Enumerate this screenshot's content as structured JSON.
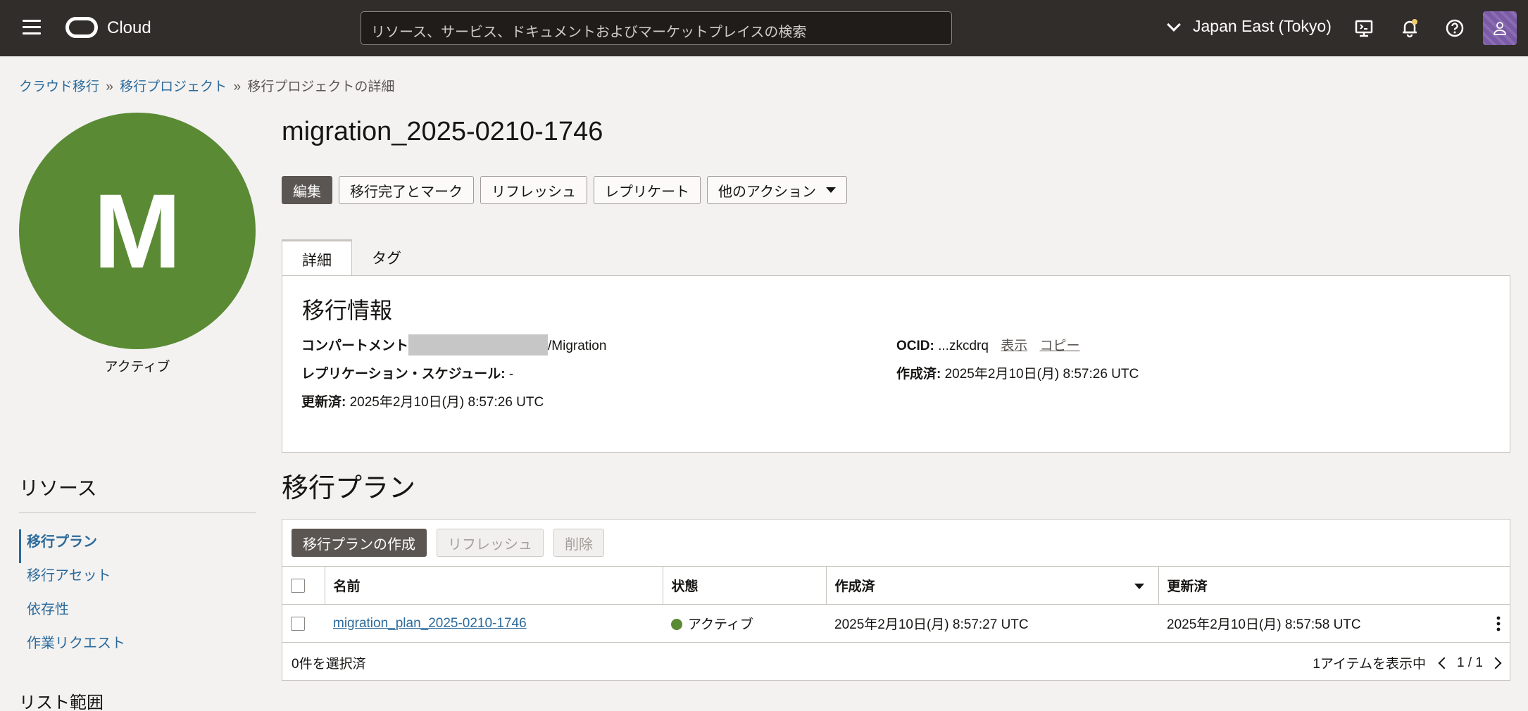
{
  "header": {
    "brand": "Cloud",
    "search_placeholder": "リソース、サービス、ドキュメントおよびマーケットプレイスの検索",
    "region": "Japan East (Tokyo)"
  },
  "breadcrumb": {
    "items": [
      "クラウド移行",
      "移行プロジェクト"
    ],
    "current": "移行プロジェクトの詳細",
    "sep": "»"
  },
  "avatar": {
    "letter": "M",
    "status": "アクティブ",
    "color": "#5a8a34"
  },
  "page": {
    "title": "migration_2025-0210-1746"
  },
  "actions": {
    "edit": "編集",
    "mark_complete": "移行完了とマーク",
    "refresh": "リフレッシュ",
    "replicate": "レプリケート",
    "more": "他のアクション"
  },
  "tabs": [
    "詳細",
    "タグ"
  ],
  "info": {
    "title": "移行情報",
    "compartment_label": "コンパートメント",
    "compartment_value": "/Migration",
    "ocid_label": "OCID:",
    "ocid_value": "...zkcdrq",
    "show": "表示",
    "copy": "コピー",
    "schedule_label": "レプリケーション・スケジュール:",
    "schedule_value": "-",
    "created_label": "作成済:",
    "created_value": "2025年2月10日(月) 8:57:26 UTC",
    "updated_label": "更新済:",
    "updated_value": "2025年2月10日(月) 8:57:26 UTC"
  },
  "resources": {
    "title": "リソース",
    "items": [
      "移行プラン",
      "移行アセット",
      "依存性",
      "作業リクエスト"
    ],
    "list_scope": "リスト範囲"
  },
  "plans": {
    "title": "移行プラン",
    "create": "移行プランの作成",
    "refresh": "リフレッシュ",
    "delete": "削除",
    "columns": [
      "名前",
      "状態",
      "作成済",
      "更新済"
    ],
    "rows": [
      {
        "name": "migration_plan_2025-0210-1746",
        "state": "アクティブ",
        "created": "2025年2月10日(月) 8:57:27 UTC",
        "updated": "2025年2月10日(月) 8:57:58 UTC"
      }
    ],
    "selected": "0件を選択済",
    "showing": "1アイテムを表示中",
    "page": "1 / 1"
  },
  "colors": {
    "header_bg": "#312d2a",
    "link": "#2c6a9a",
    "active_green": "#5a8a34"
  }
}
